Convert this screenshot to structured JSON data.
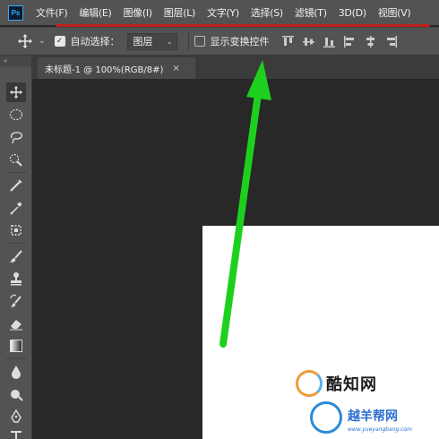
{
  "app": {
    "logo_text": "Ps"
  },
  "menu": {
    "items": [
      {
        "label": "文件(F)"
      },
      {
        "label": "编辑(E)"
      },
      {
        "label": "图像(I)"
      },
      {
        "label": "图层(L)"
      },
      {
        "label": "文字(Y)"
      },
      {
        "label": "选择(S)"
      },
      {
        "label": "滤镜(T)"
      },
      {
        "label": "3D(D)"
      },
      {
        "label": "视图(V)"
      }
    ]
  },
  "options_bar": {
    "auto_select_label": "自动选择：",
    "auto_select_checked": true,
    "auto_select_target": "图层",
    "show_transform_label": "显示变换控件",
    "show_transform_checked": false
  },
  "toolbar": {
    "collapse_glyph": "»"
  },
  "document_tab": {
    "title": "未标题-1 @ 100%(RGB/8#)",
    "close_glyph": "×"
  },
  "watermarks": {
    "cool_text": "酷知网",
    "yue_text": "越羊帮网",
    "yue_url": "www.yueyangbang.com"
  },
  "colors": {
    "menu_bg": "#535353",
    "canvas_bg": "#282828",
    "annotation_arrow": "#22dd22",
    "annotation_underline": "#c0201e"
  }
}
